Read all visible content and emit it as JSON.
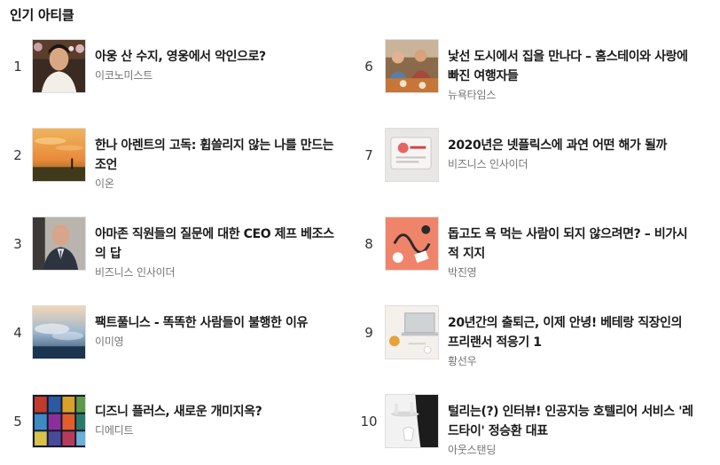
{
  "section": {
    "title": "인기 아티클"
  },
  "articles_left": [
    {
      "rank": "1",
      "title": "아웅 산 수지, 영웅에서 악인으로?",
      "source": "이코노미스트",
      "thumb": "portrait-woman-flowers"
    },
    {
      "rank": "2",
      "title": "한나 아렌트의 고독: 휩쓸리지 않는 나를 만드는 조언",
      "source": "이온",
      "thumb": "sunset-field"
    },
    {
      "rank": "3",
      "title": "아마존 직원들의 질문에 대한 CEO 제프 베조스의 답",
      "source": "비즈니스 인사이더",
      "thumb": "man-in-suit"
    },
    {
      "rank": "4",
      "title": "팩트풀니스 - 똑똑한 사람들이 불행한 이유",
      "source": "이미영",
      "thumb": "sky-clouds"
    },
    {
      "rank": "5",
      "title": "디즈니 플러스, 새로운 개미지옥?",
      "source": "디에디트",
      "thumb": "movie-posters"
    }
  ],
  "articles_right": [
    {
      "rank": "6",
      "title": "낯선 도시에서 집을 만나다 – 홈스테이와 사랑에 빠진 여행자들",
      "source": "뉴욕타임스",
      "thumb": "people-dining"
    },
    {
      "rank": "7",
      "title": "2020년은 넷플릭스에 과연 어떤 해가 될까",
      "source": "비즈니스 인사이더",
      "thumb": "tablet-red"
    },
    {
      "rank": "8",
      "title": "돕고도 욕 먹는 사람이 되지 않으려면? – 비가시적 지지",
      "source": "박진영",
      "thumb": "orange-illustration"
    },
    {
      "rank": "9",
      "title": "20년간의 출퇴근, 이제 안녕! 베테랑 직장인의 프리랜서 적응기 1",
      "source": "황선우",
      "thumb": "laptop-desk"
    },
    {
      "rank": "10",
      "title": "털리는(?) 인터뷰! 인공지능 호텔리어 서비스 '레드타이' 정승환 대표",
      "source": "아웃스탠딩",
      "thumb": "waiter-tray"
    }
  ]
}
